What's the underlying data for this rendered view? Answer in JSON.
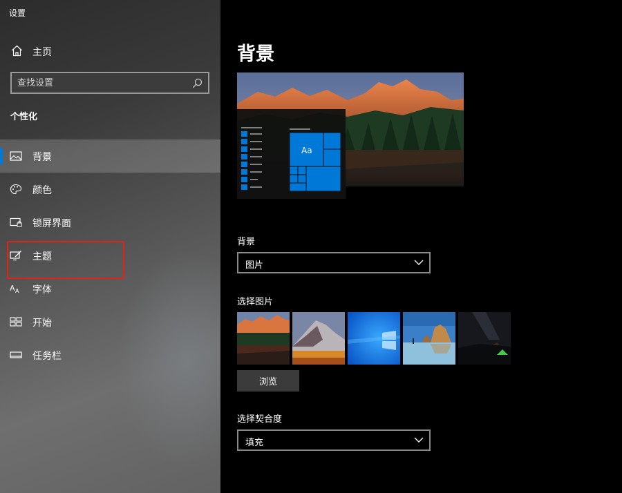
{
  "window": {
    "title": "设置"
  },
  "sidebar": {
    "home_label": "主页",
    "search": {
      "placeholder": "查找设置"
    },
    "section_heading": "个性化",
    "items": [
      {
        "label": "背景",
        "icon": "picture-icon",
        "active": true
      },
      {
        "label": "颜色",
        "icon": "palette-icon",
        "active": false
      },
      {
        "label": "锁屏界面",
        "icon": "lock-screen-icon",
        "active": false
      },
      {
        "label": "主题",
        "icon": "theme-icon",
        "active": false,
        "highlighted": true
      },
      {
        "label": "字体",
        "icon": "font-icon",
        "active": false
      },
      {
        "label": "开始",
        "icon": "start-icon",
        "active": false
      },
      {
        "label": "任务栏",
        "icon": "taskbar-icon",
        "active": false
      }
    ]
  },
  "main": {
    "title": "背景",
    "preview": {
      "tile_label": "Aa"
    },
    "background_field": {
      "label": "背景",
      "value": "图片"
    },
    "choose_picture": {
      "label": "选择图片"
    },
    "browse_label": "浏览",
    "fit_field": {
      "label": "选择契合度",
      "value": "填充"
    }
  },
  "colors": {
    "accent": "#0078d7",
    "highlight": "#e2231a"
  }
}
